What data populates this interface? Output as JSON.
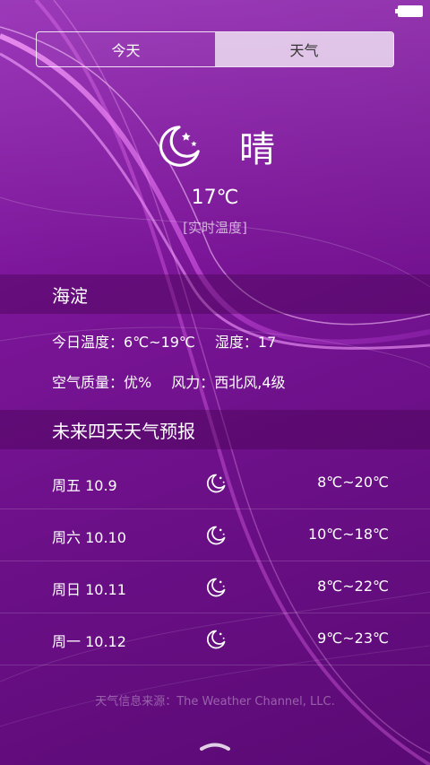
{
  "status_bar": {
    "battery_icon": "battery-icon"
  },
  "tabs": [
    {
      "label": "今天",
      "active": false
    },
    {
      "label": "天气",
      "active": true
    }
  ],
  "current": {
    "condition_icon": "moon-stars-icon",
    "condition": "晴",
    "temperature": "17℃",
    "temperature_note": "[实时温度]"
  },
  "city": {
    "name": "海淀"
  },
  "details": {
    "today_temp_label": "今日温度：",
    "today_temp": "6℃~19℃",
    "humidity_label": "湿度：",
    "humidity": "17",
    "air_quality_label": "空气质量：",
    "air_quality": "优%",
    "wind_label": "风力：",
    "wind": "西北风,4级"
  },
  "forecast": {
    "title": "未来四天天气预报",
    "days": [
      {
        "day": "周五 10.9",
        "icon": "moon-stars-icon",
        "range": "8℃~20℃"
      },
      {
        "day": "周六 10.10",
        "icon": "moon-stars-icon",
        "range": "10℃~18℃"
      },
      {
        "day": "周日 10.11",
        "icon": "moon-stars-icon",
        "range": "8℃~22℃"
      },
      {
        "day": "周一 10.12",
        "icon": "moon-stars-icon",
        "range": "9℃~23℃"
      }
    ]
  },
  "source": "天气信息来源：The Weather Channel, LLC.",
  "colors": {
    "background_top": "#8e1fb0",
    "background_bottom": "#5a0a74",
    "swoosh": "#f07af5",
    "active_tab": "#d9c9de"
  }
}
